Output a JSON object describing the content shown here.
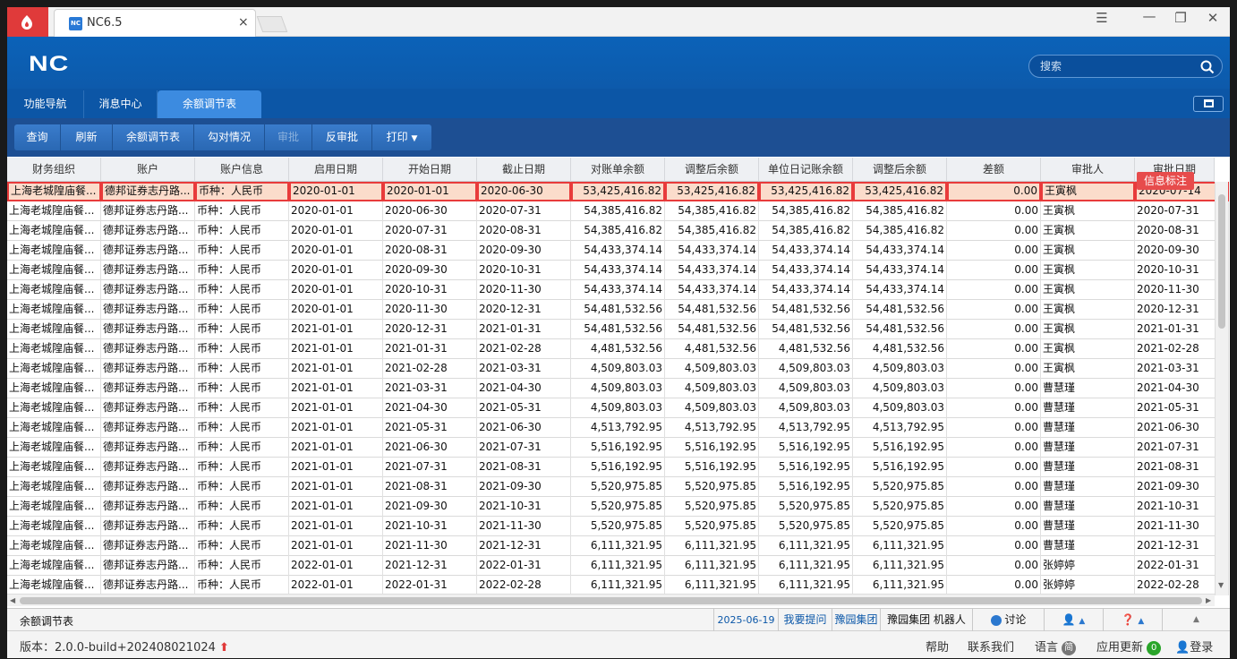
{
  "browser": {
    "tab_title": "NC6.5",
    "tab_favicon_text": "NC",
    "close_label": "×"
  },
  "header": {
    "logo_text": "NC",
    "search_placeholder": "搜索"
  },
  "nav": {
    "tabs": [
      {
        "label": "功能导航"
      },
      {
        "label": "消息中心"
      },
      {
        "label": "余额调节表",
        "active": true
      }
    ]
  },
  "toolbar": {
    "buttons": [
      {
        "label": "查询"
      },
      {
        "label": "刷新"
      },
      {
        "label": "余额调节表"
      },
      {
        "label": "勾对情况"
      },
      {
        "label": "审批",
        "disabled": true
      },
      {
        "label": "反审批"
      },
      {
        "label": "打印"
      }
    ]
  },
  "table": {
    "columns": [
      "财务组织",
      "账户",
      "账户信息",
      "启用日期",
      "开始日期",
      "截止日期",
      "对账单余额",
      "调整后余额",
      "单位日记账余额",
      "调整后余额",
      "差额",
      "审批人",
      "审批日期"
    ],
    "note_badge": "信息标注",
    "rows": [
      [
        "上海老城隍庙餐...",
        "德邦证券志丹路...",
        "币种：人民币",
        "2020-01-01",
        "2020-01-01",
        "2020-06-30",
        "53,425,416.82",
        "53,425,416.82",
        "53,425,416.82",
        "53,425,416.82",
        "0.00",
        "王寅枫",
        "2020-07-14"
      ],
      [
        "上海老城隍庙餐...",
        "德邦证券志丹路...",
        "币种：人民币",
        "2020-01-01",
        "2020-06-30",
        "2020-07-31",
        "54,385,416.82",
        "54,385,416.82",
        "54,385,416.82",
        "54,385,416.82",
        "0.00",
        "王寅枫",
        "2020-07-31"
      ],
      [
        "上海老城隍庙餐...",
        "德邦证券志丹路...",
        "币种：人民币",
        "2020-01-01",
        "2020-07-31",
        "2020-08-31",
        "54,385,416.82",
        "54,385,416.82",
        "54,385,416.82",
        "54,385,416.82",
        "0.00",
        "王寅枫",
        "2020-08-31"
      ],
      [
        "上海老城隍庙餐...",
        "德邦证券志丹路...",
        "币种：人民币",
        "2020-01-01",
        "2020-08-31",
        "2020-09-30",
        "54,433,374.14",
        "54,433,374.14",
        "54,433,374.14",
        "54,433,374.14",
        "0.00",
        "王寅枫",
        "2020-09-30"
      ],
      [
        "上海老城隍庙餐...",
        "德邦证券志丹路...",
        "币种：人民币",
        "2020-01-01",
        "2020-09-30",
        "2020-10-31",
        "54,433,374.14",
        "54,433,374.14",
        "54,433,374.14",
        "54,433,374.14",
        "0.00",
        "王寅枫",
        "2020-10-31"
      ],
      [
        "上海老城隍庙餐...",
        "德邦证券志丹路...",
        "币种：人民币",
        "2020-01-01",
        "2020-10-31",
        "2020-11-30",
        "54,433,374.14",
        "54,433,374.14",
        "54,433,374.14",
        "54,433,374.14",
        "0.00",
        "王寅枫",
        "2020-11-30"
      ],
      [
        "上海老城隍庙餐...",
        "德邦证券志丹路...",
        "币种：人民币",
        "2020-01-01",
        "2020-11-30",
        "2020-12-31",
        "54,481,532.56",
        "54,481,532.56",
        "54,481,532.56",
        "54,481,532.56",
        "0.00",
        "王寅枫",
        "2020-12-31"
      ],
      [
        "上海老城隍庙餐...",
        "德邦证券志丹路...",
        "币种：人民币",
        "2021-01-01",
        "2020-12-31",
        "2021-01-31",
        "54,481,532.56",
        "54,481,532.56",
        "54,481,532.56",
        "54,481,532.56",
        "0.00",
        "王寅枫",
        "2021-01-31"
      ],
      [
        "上海老城隍庙餐...",
        "德邦证券志丹路...",
        "币种：人民币",
        "2021-01-01",
        "2021-01-31",
        "2021-02-28",
        "4,481,532.56",
        "4,481,532.56",
        "4,481,532.56",
        "4,481,532.56",
        "0.00",
        "王寅枫",
        "2021-02-28"
      ],
      [
        "上海老城隍庙餐...",
        "德邦证券志丹路...",
        "币种：人民币",
        "2021-01-01",
        "2021-02-28",
        "2021-03-31",
        "4,509,803.03",
        "4,509,803.03",
        "4,509,803.03",
        "4,509,803.03",
        "0.00",
        "王寅枫",
        "2021-03-31"
      ],
      [
        "上海老城隍庙餐...",
        "德邦证券志丹路...",
        "币种：人民币",
        "2021-01-01",
        "2021-03-31",
        "2021-04-30",
        "4,509,803.03",
        "4,509,803.03",
        "4,509,803.03",
        "4,509,803.03",
        "0.00",
        "曹慧瑾",
        "2021-04-30"
      ],
      [
        "上海老城隍庙餐...",
        "德邦证券志丹路...",
        "币种：人民币",
        "2021-01-01",
        "2021-04-30",
        "2021-05-31",
        "4,509,803.03",
        "4,509,803.03",
        "4,509,803.03",
        "4,509,803.03",
        "0.00",
        "曹慧瑾",
        "2021-05-31"
      ],
      [
        "上海老城隍庙餐...",
        "德邦证券志丹路...",
        "币种：人民币",
        "2021-01-01",
        "2021-05-31",
        "2021-06-30",
        "4,513,792.95",
        "4,513,792.95",
        "4,513,792.95",
        "4,513,792.95",
        "0.00",
        "曹慧瑾",
        "2021-06-30"
      ],
      [
        "上海老城隍庙餐...",
        "德邦证券志丹路...",
        "币种：人民币",
        "2021-01-01",
        "2021-06-30",
        "2021-07-31",
        "5,516,192.95",
        "5,516,192.95",
        "5,516,192.95",
        "5,516,192.95",
        "0.00",
        "曹慧瑾",
        "2021-07-31"
      ],
      [
        "上海老城隍庙餐...",
        "德邦证券志丹路...",
        "币种：人民币",
        "2021-01-01",
        "2021-07-31",
        "2021-08-31",
        "5,516,192.95",
        "5,516,192.95",
        "5,516,192.95",
        "5,516,192.95",
        "0.00",
        "曹慧瑾",
        "2021-08-31"
      ],
      [
        "上海老城隍庙餐...",
        "德邦证券志丹路...",
        "币种：人民币",
        "2021-01-01",
        "2021-08-31",
        "2021-09-30",
        "5,520,975.85",
        "5,520,975.85",
        "5,516,192.95",
        "5,520,975.85",
        "0.00",
        "曹慧瑾",
        "2021-09-30"
      ],
      [
        "上海老城隍庙餐...",
        "德邦证券志丹路...",
        "币种：人民币",
        "2021-01-01",
        "2021-09-30",
        "2021-10-31",
        "5,520,975.85",
        "5,520,975.85",
        "5,520,975.85",
        "5,520,975.85",
        "0.00",
        "曹慧瑾",
        "2021-10-31"
      ],
      [
        "上海老城隍庙餐...",
        "德邦证券志丹路...",
        "币种：人民币",
        "2021-01-01",
        "2021-10-31",
        "2021-11-30",
        "5,520,975.85",
        "5,520,975.85",
        "5,520,975.85",
        "5,520,975.85",
        "0.00",
        "曹慧瑾",
        "2021-11-30"
      ],
      [
        "上海老城隍庙餐...",
        "德邦证券志丹路...",
        "币种：人民币",
        "2021-01-01",
        "2021-11-30",
        "2021-12-31",
        "6,111,321.95",
        "6,111,321.95",
        "6,111,321.95",
        "6,111,321.95",
        "0.00",
        "曹慧瑾",
        "2021-12-31"
      ],
      [
        "上海老城隍庙餐...",
        "德邦证券志丹路...",
        "币种：人民币",
        "2022-01-01",
        "2021-12-31",
        "2022-01-31",
        "6,111,321.95",
        "6,111,321.95",
        "6,111,321.95",
        "6,111,321.95",
        "0.00",
        "张婷婷",
        "2022-01-31"
      ],
      [
        "上海老城隍庙餐...",
        "德邦证券志丹路...",
        "币种：人民币",
        "2022-01-01",
        "2022-01-31",
        "2022-02-28",
        "6,111,321.95",
        "6,111,321.95",
        "6,111,321.95",
        "6,111,321.95",
        "0.00",
        "张婷婷",
        "2022-02-28"
      ]
    ]
  },
  "statusbar": {
    "title": "余额调节表",
    "date": "2025-06-19",
    "ask": "我要提问",
    "group1": "豫园集团",
    "group2": "豫园集团 机器人",
    "discuss": "讨论"
  },
  "bottombar": {
    "version": "版本：2.0.0-build+202408021024",
    "help": "帮助",
    "contact": "联系我们",
    "language": "语言",
    "language_badge": "简",
    "updates": "应用更新",
    "updates_count": "0",
    "login": "登录"
  },
  "colors": {
    "header_blue": "#0b62b8",
    "selected_row": "#fbdccb",
    "selected_border": "#e83b3b",
    "badge_red": "#e74c4c"
  }
}
